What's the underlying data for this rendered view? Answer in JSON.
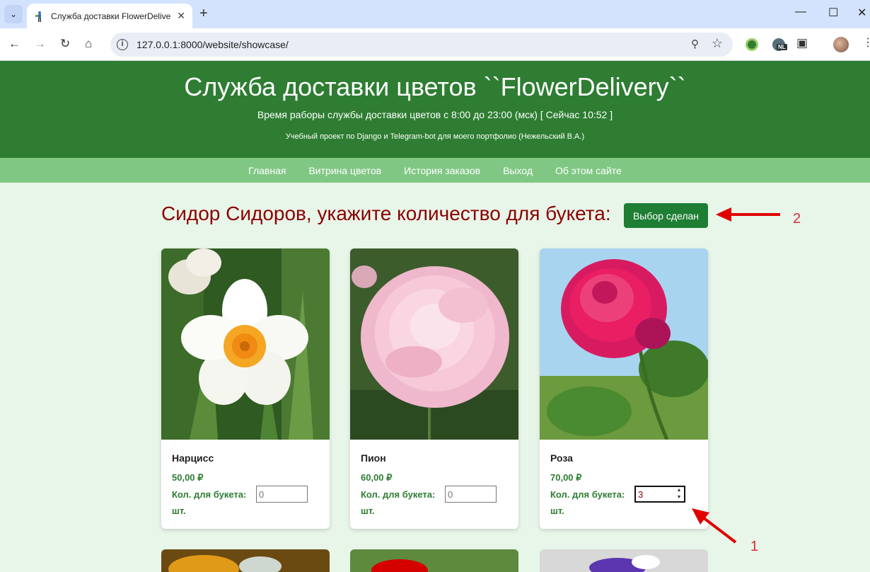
{
  "browser": {
    "tab_title": "Служба доставки FlowerDelive",
    "url": "127.0.0.1:8000/website/showcase/",
    "ext_badge": "NL"
  },
  "header": {
    "title": "Служба доставки цветов ``FlowerDelivery``",
    "hours": "Время раборы службы доставки цветов с 8:00 до 23:00 (мск) [ Сейчас 10:52 ]",
    "subtitle": "Учебный проект по Django и Telegram-bot для моего портфолио (Нежельский В.А.)"
  },
  "nav": {
    "items": [
      {
        "label": "Главная"
      },
      {
        "label": "Витрина цветов"
      },
      {
        "label": "История заказов"
      },
      {
        "label": "Выход"
      },
      {
        "label": "Об этом сайте"
      }
    ]
  },
  "main": {
    "heading": "Сидор Сидоров, укажите количество для букета:",
    "done_button": "Выбор сделан",
    "products": [
      {
        "name": "Нарцисс",
        "price": "50,00 ₽",
        "qty_label": "Кол. для букета:",
        "qty_placeholder": "0",
        "qty_value": "",
        "unit": "шт."
      },
      {
        "name": "Пион",
        "price": "60,00 ₽",
        "qty_label": "Кол. для букета:",
        "qty_placeholder": "0",
        "qty_value": "",
        "unit": "шт."
      },
      {
        "name": "Роза",
        "price": "70,00 ₽",
        "qty_label": "Кол. для букета:",
        "qty_placeholder": "0",
        "qty_value": "3",
        "unit": "шт."
      }
    ]
  },
  "annotations": {
    "arrow1_label": "1",
    "arrow2_label": "2",
    "color": "#e00000"
  }
}
